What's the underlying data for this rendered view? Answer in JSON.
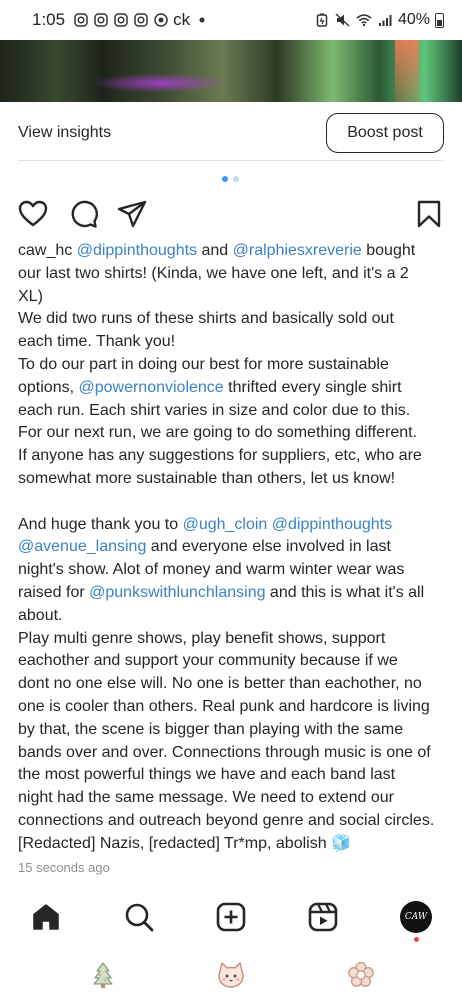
{
  "status_bar": {
    "time": "1:05",
    "carrier_text": "ck",
    "battery": "40%",
    "icons": [
      "instagram-icon",
      "instagram-icon",
      "instagram-icon",
      "instagram-icon",
      "media-icon",
      "dot-icon",
      "battery-saver-icon",
      "mute-icon",
      "wifi-icon",
      "signal-icon",
      "battery-icon"
    ]
  },
  "post": {
    "view_insights_label": "View insights",
    "boost_post_label": "Boost post",
    "carousel": {
      "count": 2,
      "active_index": 0
    },
    "actions": [
      "heart-icon",
      "comment-icon",
      "share-icon",
      "bookmark-icon"
    ],
    "caption_lines": [
      [
        {
          "t": "caw_hc ",
          "c": "username"
        },
        {
          "t": "@dippinthoughts",
          "c": "mention"
        },
        {
          "t": " and ",
          "c": ""
        },
        {
          "t": "@ralphiesxreverie",
          "c": "mention"
        },
        {
          "t": " bought",
          "c": ""
        }
      ],
      [
        {
          "t": "our last two shirts! (Kinda, we have one left, and it's a 2",
          "c": ""
        }
      ],
      [
        {
          "t": "XL)",
          "c": ""
        }
      ],
      [
        {
          "t": "We did two runs of these shirts and basically sold out",
          "c": ""
        }
      ],
      [
        {
          "t": "each time. Thank you!",
          "c": ""
        }
      ],
      [
        {
          "t": "To do our part in doing our best for more sustainable",
          "c": ""
        }
      ],
      [
        {
          "t": "options, ",
          "c": ""
        },
        {
          "t": "@powernonviolence",
          "c": "mention"
        },
        {
          "t": " thrifted every single shirt",
          "c": ""
        }
      ],
      [
        {
          "t": "each run. Each shirt varies in size and color due to this.",
          "c": ""
        }
      ],
      [
        {
          "t": "For our next run, we are going to do something different.",
          "c": ""
        }
      ],
      [
        {
          "t": "If anyone has any suggestions for suppliers, etc, who are",
          "c": ""
        }
      ],
      [
        {
          "t": "somewhat more sustainable than others, let us know!",
          "c": ""
        }
      ],
      [],
      [
        {
          "t": "And huge thank you to ",
          "c": ""
        },
        {
          "t": "@ugh_cloin",
          "c": "mention"
        },
        {
          "t": " ",
          "c": ""
        },
        {
          "t": "@dippinthoughts",
          "c": "mention"
        }
      ],
      [
        {
          "t": "@avenue_lansing",
          "c": "mention"
        },
        {
          "t": " and everyone else involved in last",
          "c": ""
        }
      ],
      [
        {
          "t": "night's show. Alot of money and warm winter wear was",
          "c": ""
        }
      ],
      [
        {
          "t": "raised for ",
          "c": ""
        },
        {
          "t": "@punkswithlunchlansing",
          "c": "mention"
        },
        {
          "t": " and this is what it's all",
          "c": ""
        }
      ],
      [
        {
          "t": "about.",
          "c": ""
        }
      ],
      [
        {
          "t": "Play multi genre shows, play benefit shows, support",
          "c": ""
        }
      ],
      [
        {
          "t": "eachother and support your community because if we",
          "c": ""
        }
      ],
      [
        {
          "t": "dont no one else will. No one is better than eachother, no",
          "c": ""
        }
      ],
      [
        {
          "t": "one is cooler than others. Real punk and hardcore is living",
          "c": ""
        }
      ],
      [
        {
          "t": "by that, the scene is bigger than playing with the same",
          "c": ""
        }
      ],
      [
        {
          "t": "bands over and over. Connections through music is one of",
          "c": ""
        }
      ],
      [
        {
          "t": "the most powerful things we have and each band last",
          "c": ""
        }
      ],
      [
        {
          "t": "night had the same message. We need to extend our",
          "c": ""
        }
      ],
      [
        {
          "t": "connections and outreach beyond genre and social circles.",
          "c": ""
        }
      ],
      [
        {
          "t": "[Redacted] Nazis, [redacted] Tr*mp, abolish 🧊",
          "c": ""
        }
      ]
    ],
    "timestamp": "15 seconds ago"
  },
  "bottom_nav": {
    "items": [
      "home-icon",
      "search-icon",
      "create-icon",
      "reels-icon",
      "profile-avatar"
    ],
    "avatar_text": "CAW"
  },
  "system_nav": {
    "items": [
      "tree-icon",
      "cat-icon",
      "flower-icon"
    ]
  },
  "colors": {
    "mention": "#3b82c4",
    "text": "#262626",
    "muted": "#8e8e8e",
    "carousel_active": "#3897f0",
    "notification": "#ed4956"
  }
}
